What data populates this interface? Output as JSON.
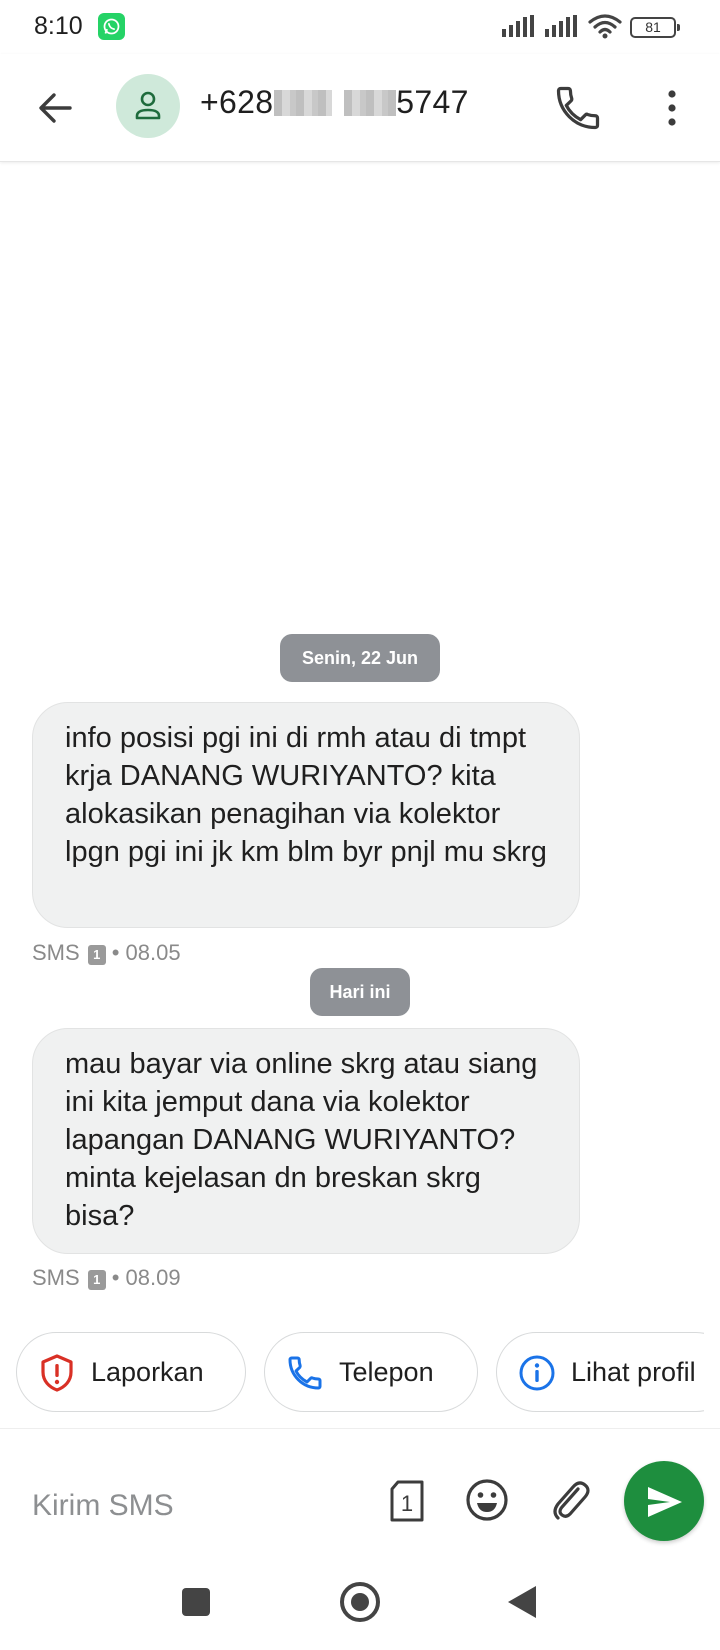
{
  "status_bar": {
    "time": "8:10",
    "battery": "81",
    "notification_icon": "whatsapp-icon"
  },
  "header": {
    "contact_prefix": "+62",
    "contact_partial_a": "8",
    "contact_partial_b": "5747",
    "icons": [
      "back-arrow-icon",
      "person-icon",
      "phone-icon",
      "more-vert-icon"
    ]
  },
  "conversation": {
    "groups": [
      {
        "date_label": "Senin, 22 Jun",
        "message": "info posisi pgi ini di rmh atau di tmpt krja DANANG WURIYANTO? kita alokasikan penagihan via kolektor lpgn pgi ini jk km blm byr pnjl mu skrg",
        "meta_prefix": "SMS",
        "sim": "1",
        "time": "• 08.05"
      },
      {
        "date_label": "Hari ini",
        "message": "mau bayar via online skrg atau siang ini kita jemput dana via kolektor lapangan DANANG WURIYANTO? minta kejelasan dn breskan skrg bisa?",
        "meta_prefix": "SMS",
        "sim": "1",
        "time": "• 08.09"
      }
    ]
  },
  "suggestions": [
    {
      "label": "Laporkan",
      "icon": "report-shield-icon",
      "color": "#d93025"
    },
    {
      "label": "Telepon",
      "icon": "phone-icon",
      "color": "#1a73e8"
    },
    {
      "label": "Lihat profil",
      "icon": "info-icon",
      "color": "#1a73e8"
    }
  ],
  "compose": {
    "placeholder": "Kirim SMS",
    "sim_number": "1",
    "send_color": "#1e8e3e"
  }
}
